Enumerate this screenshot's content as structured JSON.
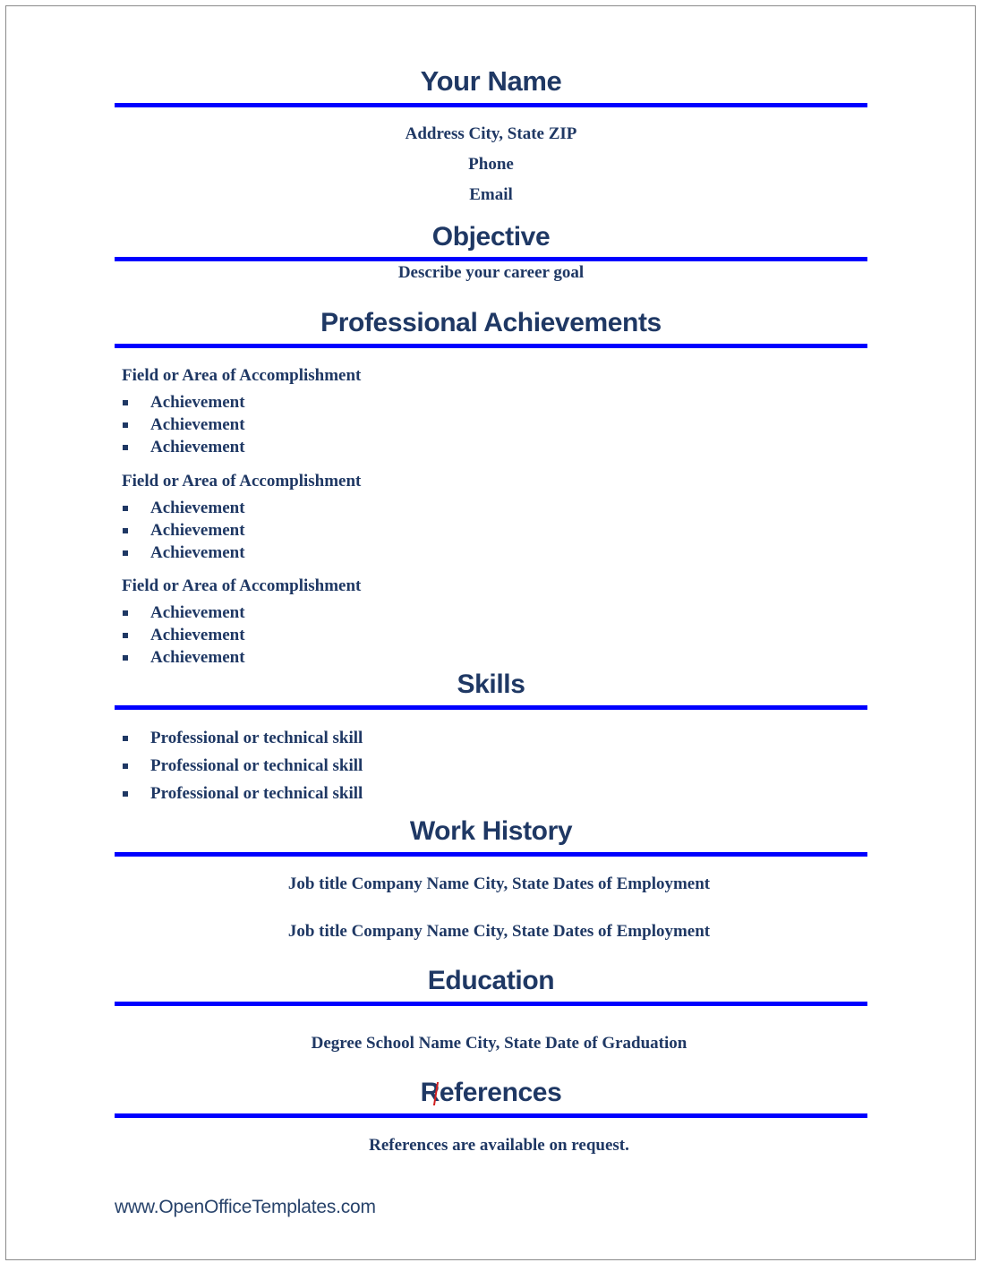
{
  "document": {
    "title": "Your Name",
    "colors": {
      "heading_navy": "#1F3864",
      "rule_blue": "#0000FF",
      "page_border": "#8A8A8A",
      "caret_red": "#D21F1F",
      "footer_navy": "#28436B"
    }
  },
  "contact": {
    "address_line": "Address  City, State  ZIP",
    "phone": "Phone",
    "email": "Email"
  },
  "objective": {
    "heading": "Objective",
    "body": "Describe your career goal"
  },
  "achievements": {
    "heading": "Professional Achievements",
    "groups": [
      {
        "title": "Field or Area of Accomplishment",
        "items": [
          "Achievement",
          "Achievement",
          "Achievement"
        ]
      },
      {
        "title": "Field or Area of Accomplishment",
        "items": [
          "Achievement",
          "Achievement",
          "Achievement"
        ]
      },
      {
        "title": "Field or Area of Accomplishment",
        "items": [
          "Achievement",
          "Achievement",
          "Achievement"
        ]
      }
    ]
  },
  "skills": {
    "heading": "Skills",
    "items": [
      "Professional or technical skill",
      "Professional or technical skill",
      "Professional or technical skill"
    ]
  },
  "work_history": {
    "heading": "Work History",
    "entries": [
      "Job title  Company Name  City, State  Dates of Employment",
      "Job title  Company Name  City, State  Dates of Employment"
    ]
  },
  "education": {
    "heading": "Education",
    "entries": [
      "Degree  School Name  City, State  Date of Graduation"
    ]
  },
  "references": {
    "heading": "References",
    "body": "References are available on request."
  },
  "footer": {
    "url": "www.OpenOfficeTemplates.com"
  }
}
